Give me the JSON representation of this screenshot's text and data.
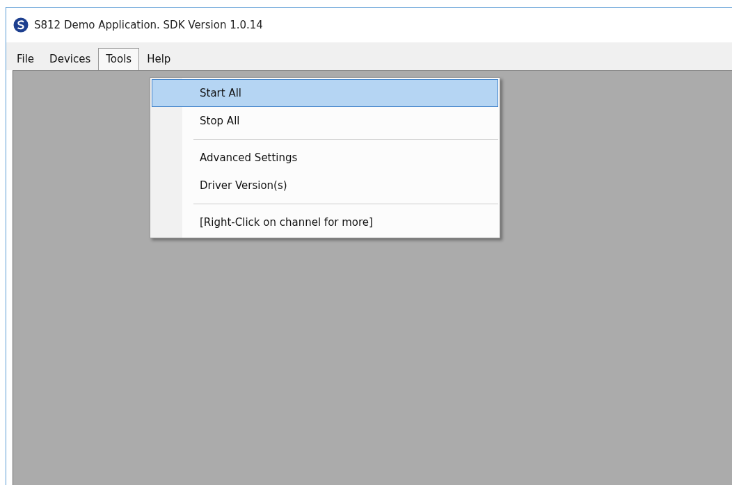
{
  "window": {
    "title": "S812 Demo Application.  SDK Version 1.0.14"
  },
  "menu_bar": [
    {
      "label": "File",
      "selected": false
    },
    {
      "label": "Devices",
      "selected": false
    },
    {
      "label": "Tools",
      "selected": true
    },
    {
      "label": "Help",
      "selected": false
    }
  ],
  "dropdown": {
    "items": [
      {
        "kind": "item",
        "label": "Start All",
        "selected": true
      },
      {
        "kind": "item",
        "label": "Stop All",
        "selected": false
      },
      {
        "kind": "separator"
      },
      {
        "kind": "item",
        "label": "Advanced Settings",
        "selected": false
      },
      {
        "kind": "item",
        "label": "Driver Version(s)",
        "selected": false
      },
      {
        "kind": "separator"
      },
      {
        "kind": "item",
        "label": "[Right-Click on channel for more]",
        "selected": false
      }
    ]
  }
}
